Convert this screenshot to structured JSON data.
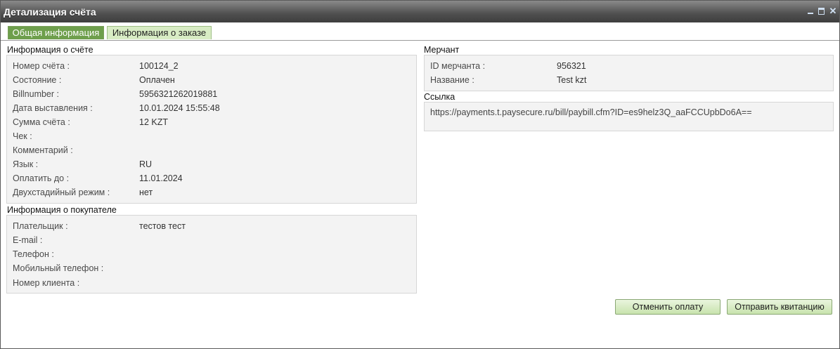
{
  "window": {
    "title": "Детализация счёта"
  },
  "tabs": [
    {
      "label": "Общая информация",
      "active": true
    },
    {
      "label": "Информация о заказе",
      "active": false
    }
  ],
  "account": {
    "title": "Информация о счёте",
    "fields": [
      {
        "label": "Номер счёта :",
        "value": "100124_2"
      },
      {
        "label": "Состояние :",
        "value": "Оплачен"
      },
      {
        "label": "Billnumber :",
        "value": "5956321262019881"
      },
      {
        "label": "Дата выставления :",
        "value": "10.01.2024 15:55:48"
      },
      {
        "label": "Сумма счёта :",
        "value": "12 KZT"
      },
      {
        "label": "Чек :",
        "value": ""
      },
      {
        "label": "Комментарий :",
        "value": ""
      },
      {
        "label": "Язык :",
        "value": "RU"
      },
      {
        "label": "Оплатить до :",
        "value": "11.01.2024"
      },
      {
        "label": "Двухстадийный режим :",
        "value": "нет"
      }
    ]
  },
  "buyer": {
    "title": "Информация о покупателе",
    "fields": [
      {
        "label": "Плательщик :",
        "value": "тестов тест"
      },
      {
        "label": "E-mail :",
        "value": ""
      },
      {
        "label": "Телефон :",
        "value": ""
      },
      {
        "label": "Мобильный телефон :",
        "value": ""
      },
      {
        "label": "Номер клиента :",
        "value": ""
      }
    ]
  },
  "merchant": {
    "title": "Мерчант",
    "fields": [
      {
        "label": "ID мерчанта :",
        "value": "956321"
      },
      {
        "label": "Название :",
        "value": "Test kzt"
      }
    ]
  },
  "link": {
    "title": "Ссылка",
    "url": "https://payments.t.paysecure.ru/bill/paybill.cfm?ID=es9helz3Q_aaFCCUpbDo6A=="
  },
  "buttons": {
    "cancel": "Отменить оплату",
    "send": "Отправить квитанцию"
  },
  "colors": {
    "tab_active": "#6e9f4c",
    "tab_inactive": "#d8ecc4",
    "panel_bg": "#f3f3f3",
    "button_bg": "#c8e3ad"
  }
}
